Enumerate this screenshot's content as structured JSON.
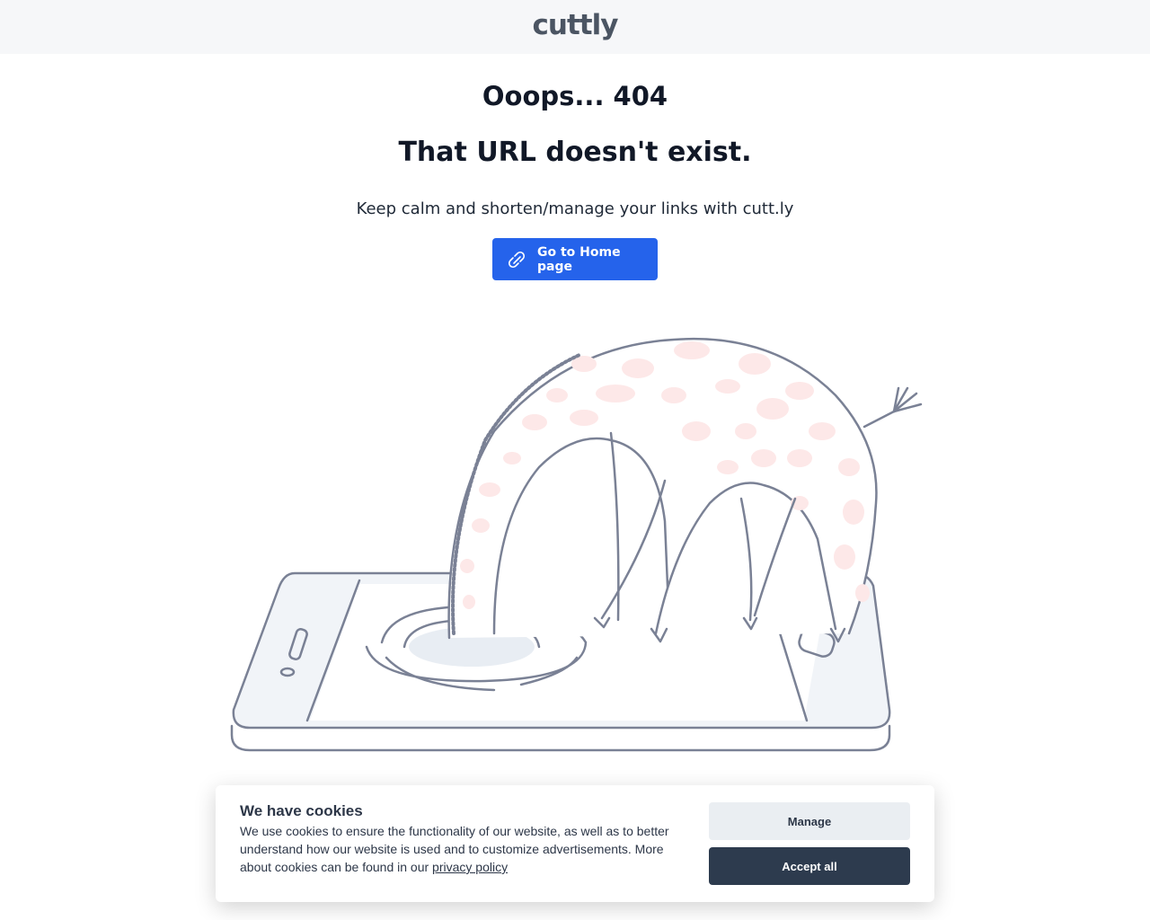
{
  "header": {
    "logo_text": "cuttly"
  },
  "main": {
    "title": "Ooops... 404",
    "subtitle": "That URL doesn't exist.",
    "tagline": "Keep calm and shorten/manage your links with cutt.ly",
    "home_button_label": "Go to Home page",
    "home_button_icon": "link-icon"
  },
  "illustration": {
    "icon": "giraffe-diving-into-phone-illustration"
  },
  "cookie_banner": {
    "title": "We have cookies",
    "text": "We use cookies to ensure the functionality of our website, as well as to better understand how our website is used and to customize advertisements. More about cookies can be found in our",
    "link_text": "privacy policy",
    "manage_label": "Manage",
    "accept_label": "Accept all"
  },
  "colors": {
    "accent": "#2563eb",
    "dark_button": "#2d3b4e",
    "light_button": "#eaeef2",
    "header_bg": "#f6f7f9",
    "spots": "#fde8e8",
    "line": "#7a8195"
  }
}
